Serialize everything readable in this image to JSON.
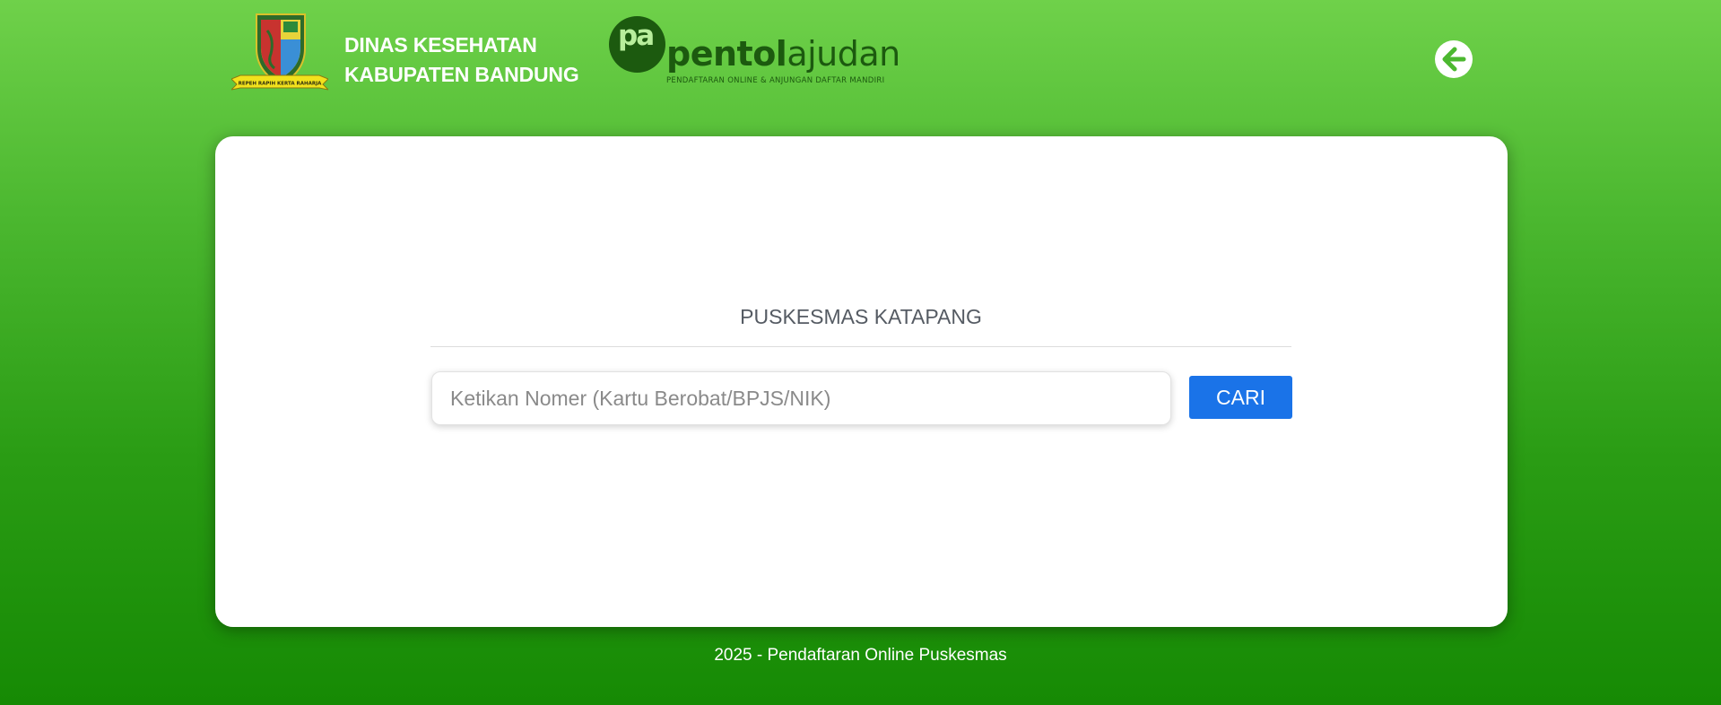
{
  "header": {
    "crest_ribbon_text": "REPEH RAPIH KERTA RAHARJA",
    "agency_line1": "DINAS KESEHATAN",
    "agency_line2": "KABUPATEN BANDUNG",
    "brand_mark": "pa",
    "brand_name_bold": "pentol",
    "brand_name_light": "ajudan",
    "brand_tagline": "Pendaftaran Online & Anjungan Daftar Mandiri",
    "back_icon": "arrow-left-circle-icon"
  },
  "main": {
    "title": "PUSKESMAS KATAPANG",
    "search_placeholder": "Ketikan Nomer (Kartu Berobat/BPJS/NIK)",
    "search_value": "",
    "search_button_label": "CARI"
  },
  "footer": {
    "text": "2025 - Pendaftaran Online Puskesmas"
  },
  "colors": {
    "background_top": "#6fd14a",
    "background_bottom": "#168a04",
    "brand_dark_green": "#1c5a0f",
    "button_blue": "#1a73e8",
    "title_gray": "#555b63"
  }
}
